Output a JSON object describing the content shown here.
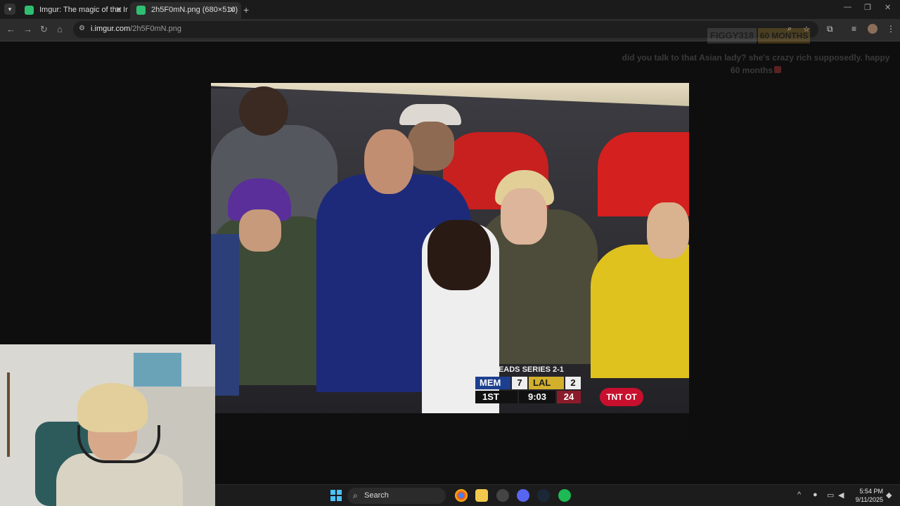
{
  "browser": {
    "tabs": [
      {
        "title": "Imgur: The magic of the Interne",
        "active": false
      },
      {
        "title": "2h5F0mN.png (680×510)",
        "active": true
      }
    ],
    "url_host": "i.imgur.com",
    "url_path": "/2h5F0mN.png",
    "icons": {
      "back": "back-arrow-icon",
      "forward": "forward-arrow-icon",
      "reload": "reload-icon",
      "home": "home-icon",
      "zoom": "zoom-icon",
      "bookmark": "star-icon",
      "extensions": "puzzle-icon",
      "media": "media-icon",
      "menu": "kebab-menu-icon"
    }
  },
  "overlay": {
    "sub_name": "FIGGY318",
    "sub_months": "60 MONTHS",
    "chat_message": "did you talk to that Asian lady? she's crazy rich supposedly. happy 60 months"
  },
  "scorebug": {
    "title": "LAL LEADS SERIES 2-1",
    "team1": "MEM",
    "team1_score": "7",
    "team2": "LAL",
    "team2_score": "2",
    "period": "1ST",
    "clock": "9:03",
    "shot_clock": "24",
    "network": "TNT OT",
    "colors": {
      "mem": "#1c3f8f",
      "lal": "#d2b02c",
      "shot": "#8b1b2a"
    }
  },
  "taskbar": {
    "search_label": "Search",
    "time": "5:54 PM",
    "date": "9/11/2025"
  }
}
